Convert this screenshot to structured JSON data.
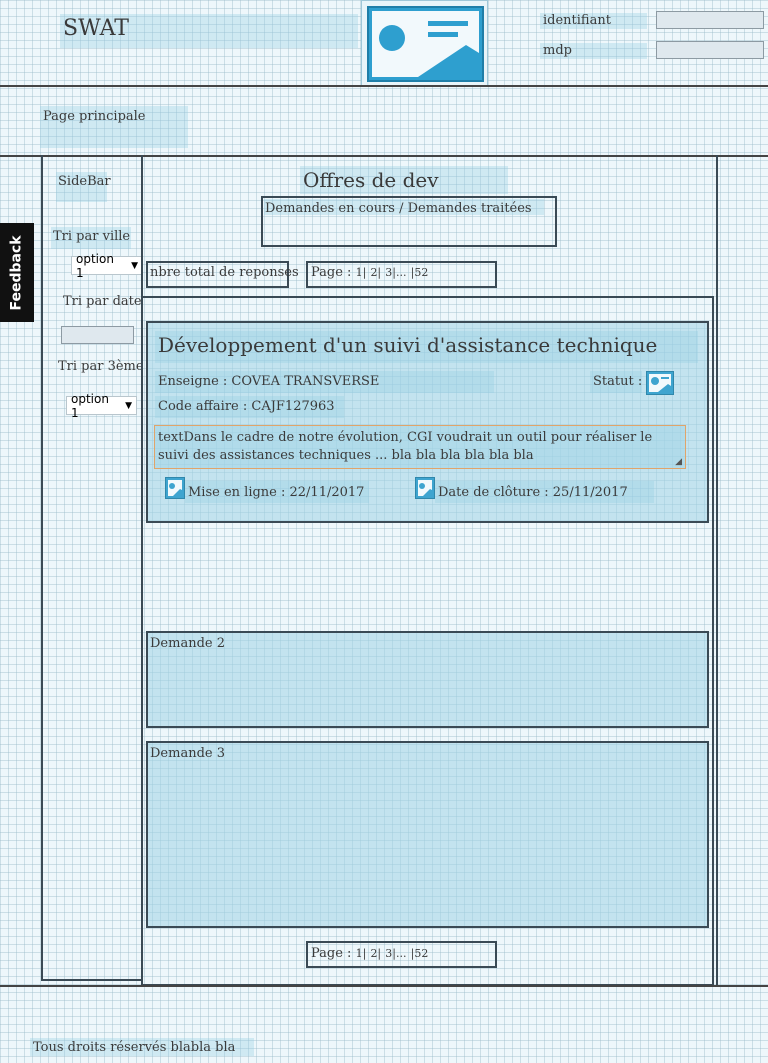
{
  "header": {
    "app_title": "SWAT",
    "login_label": "identifiant",
    "password_label": "mdp",
    "login_value": "",
    "password_value": ""
  },
  "nav": {
    "home_link": "Page principale"
  },
  "feedback": {
    "label": "Feedback"
  },
  "sidebar": {
    "title": "SideBar",
    "filter_city_label": "Tri par ville",
    "filter_city_value": "option 1",
    "filter_date_label": "Tri par date",
    "filter_date_value": "",
    "filter_third_label": "Tri par 3ème",
    "filter_third_value": "option 1"
  },
  "main": {
    "title": "Offres de dev",
    "tabs_label": "Demandes en cours / Demandes traitées",
    "total_label": "nbre total de reponses",
    "pagination": {
      "prefix": "Page : ",
      "p1": "1|",
      "p2": "2|",
      "p3": "3|...",
      "plast": "|52"
    },
    "offer": {
      "title": "Développement d'un suivi d'assistance technique",
      "brand_label": "Enseigne : COVEA TRANSVERSE",
      "status_label": "Statut :",
      "code_label": "Code affaire : CAJF127963",
      "description": "textDans le cadre de notre évolution, CGI voudrait un outil pour réaliser le suivi des assistances techniques ... bla bla bla bla bla bla",
      "online_label": "Mise en ligne : 22/11/2017",
      "closing_label": "Date de clôture : 25/11/2017"
    },
    "request2": "Demande 2",
    "request3": "Demande 3"
  },
  "footer": {
    "copyright": "Tous droits réservés blabla bla"
  }
}
